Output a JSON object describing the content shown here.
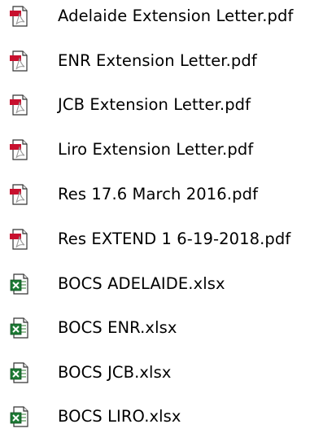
{
  "files": [
    {
      "name": "Adelaide Extension Letter.pdf",
      "type": "pdf",
      "icon": "pdf-file-icon"
    },
    {
      "name": "ENR Extension Letter.pdf",
      "type": "pdf",
      "icon": "pdf-file-icon"
    },
    {
      "name": "JCB Extension Letter.pdf",
      "type": "pdf",
      "icon": "pdf-file-icon"
    },
    {
      "name": "Liro Extension Letter.pdf",
      "type": "pdf",
      "icon": "pdf-file-icon"
    },
    {
      "name": "Res 17.6 March 2016.pdf",
      "type": "pdf",
      "icon": "pdf-file-icon"
    },
    {
      "name": "Res EXTEND 1 6-19-2018.pdf",
      "type": "pdf",
      "icon": "pdf-file-icon"
    },
    {
      "name": "BOCS ADELAIDE.xlsx",
      "type": "xlsx",
      "icon": "excel-file-icon"
    },
    {
      "name": "BOCS ENR.xlsx",
      "type": "xlsx",
      "icon": "excel-file-icon"
    },
    {
      "name": "BOCS JCB.xlsx",
      "type": "xlsx",
      "icon": "excel-file-icon"
    },
    {
      "name": "BOCS LIRO.xlsx",
      "type": "xlsx",
      "icon": "excel-file-icon"
    }
  ],
  "colors": {
    "pdf_accent": "#c8102e",
    "excel_accent": "#1d7a35",
    "text": "#000000"
  }
}
